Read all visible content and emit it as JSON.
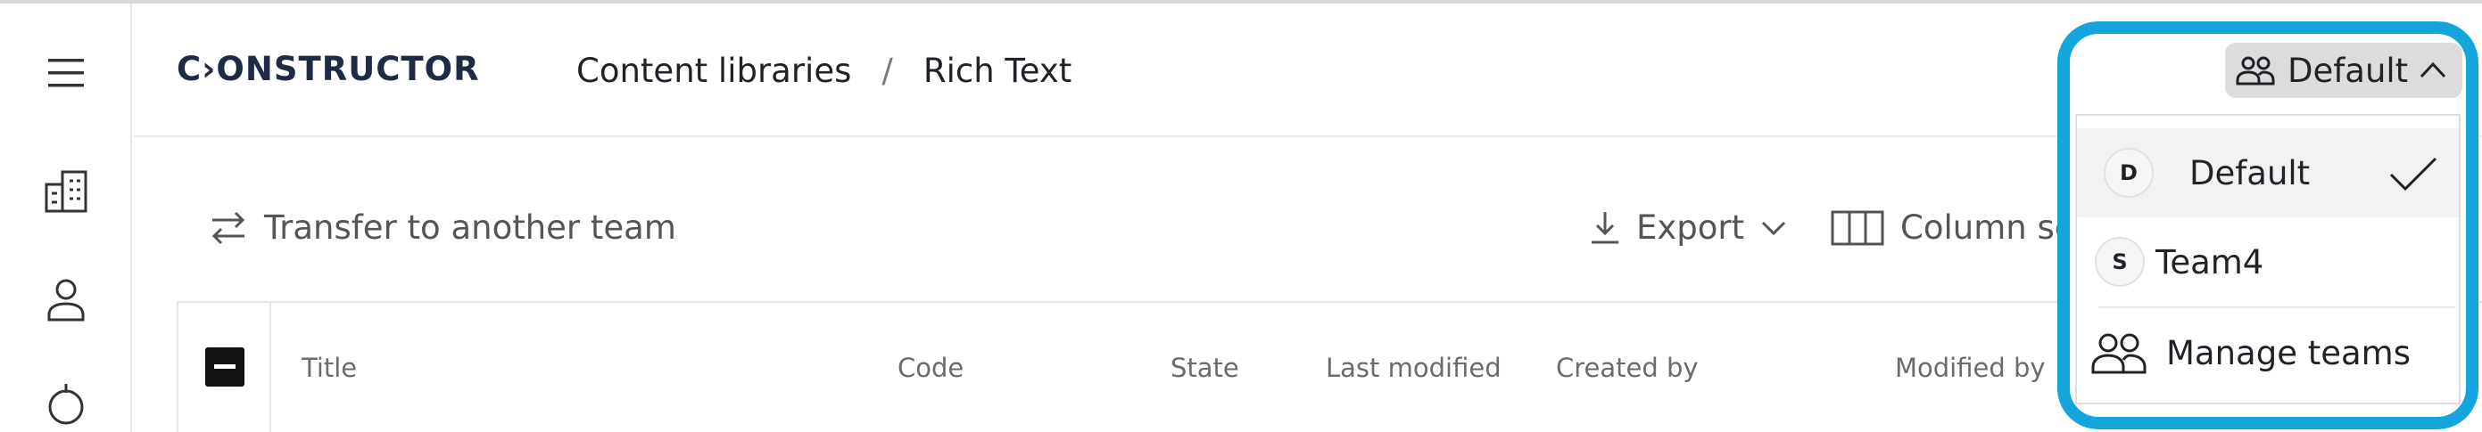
{
  "app": {
    "logo_text": "C›ONSTRUCTOR"
  },
  "breadcrumb": {
    "items": [
      "Content libraries",
      "Rich Text"
    ],
    "separator": "/"
  },
  "toolbar": {
    "transfer_label": "Transfer to another team",
    "export_label": "Export",
    "columns_label": "Column se"
  },
  "table": {
    "columns": [
      "Title",
      "Code",
      "State",
      "Last modified",
      "Created by",
      "Modified by"
    ]
  },
  "team_switcher": {
    "current_label": "Default",
    "menu": {
      "items": [
        {
          "avatar": "D",
          "label": "Default"
        },
        {
          "avatar": "S",
          "label": "Team4"
        }
      ],
      "manage_label": "Manage teams"
    }
  },
  "colors": {
    "highlight": "#14a5dc",
    "logo": "#1f2a44",
    "button_bg": "#dcdcdc"
  }
}
